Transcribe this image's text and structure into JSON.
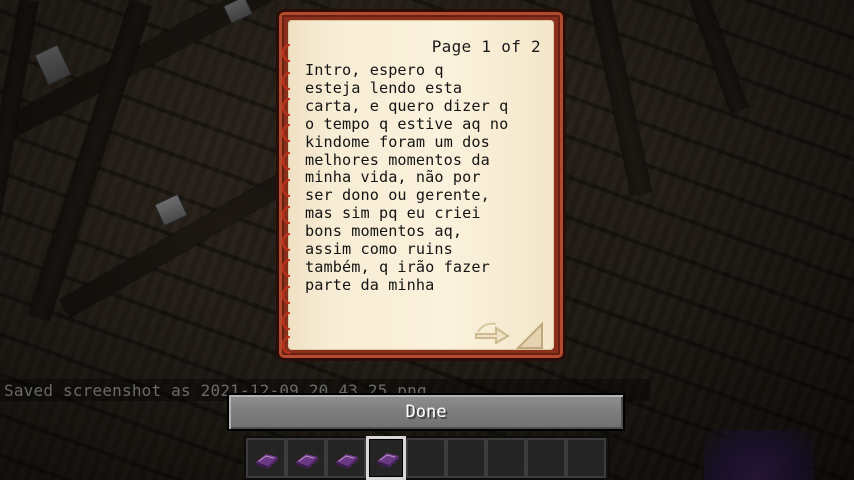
{
  "book": {
    "page_indicator": "Page 1 of 2",
    "text_lines": [
      "Intro, espero q",
      "esteja lendo esta",
      "carta, e quero dizer q",
      "o tempo q estive aq no",
      "kindome foram um dos",
      "melhores momentos da",
      "minha vida, não por",
      "ser dono ou gerente,",
      "mas sim pq eu criei",
      "bons momentos aq,",
      "assim como ruins",
      "também, q irão fazer",
      "parte da minha"
    ],
    "next_page_icon": "arrow-right-icon",
    "cover_color": "#8a2f1c",
    "page_color": "#f7ecd4",
    "binding_color": "#c2321b"
  },
  "chat": {
    "message": "Saved screenshot as 2021-12-09_20.43.25.png"
  },
  "done_button": {
    "label": "Done"
  },
  "hotbar": {
    "slots": [
      {
        "item": "enchanted-book-icon"
      },
      {
        "item": "enchanted-book-icon"
      },
      {
        "item": "enchanted-book-icon"
      },
      {
        "item": "enchanted-book-icon",
        "selected": true
      },
      {
        "item": null
      },
      {
        "item": null
      },
      {
        "item": null
      },
      {
        "item": null
      },
      {
        "item": null
      }
    ]
  }
}
